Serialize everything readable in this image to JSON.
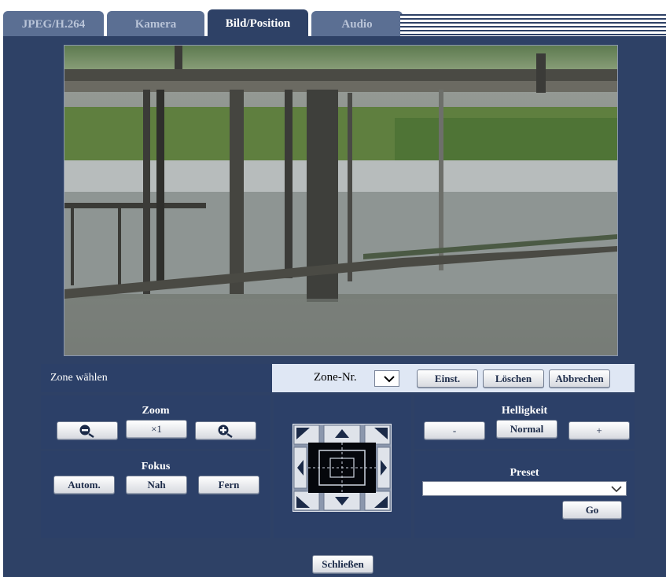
{
  "tabs": [
    {
      "label": "JPEG/H.264",
      "active": false
    },
    {
      "label": "Kamera",
      "active": false
    },
    {
      "label": "Bild/Position",
      "active": true
    },
    {
      "label": "Audio",
      "active": false
    }
  ],
  "zone": {
    "title": "Zone wählen",
    "number_label": "Zone-Nr.",
    "number_value": "",
    "set_button": "Einst.",
    "delete_button": "Löschen",
    "cancel_button": "Abbrechen"
  },
  "zoom": {
    "label": "Zoom",
    "out_icon": "zoom-out-icon",
    "reset_button": "×1",
    "in_icon": "zoom-in-icon"
  },
  "focus": {
    "label": "Fokus",
    "auto_button": "Autom.",
    "near_button": "Nah",
    "far_button": "Fern"
  },
  "brightness": {
    "label": "Helligkeit",
    "minus_button": "-",
    "normal_button": "Normal",
    "plus_button": "+"
  },
  "preset": {
    "label": "Preset",
    "selected": "",
    "go_button": "Go"
  },
  "close_button": "Schließen",
  "colors": {
    "panel": "#2c4068",
    "background": "#2e4166",
    "zone_bar": "#dfe7f4"
  }
}
